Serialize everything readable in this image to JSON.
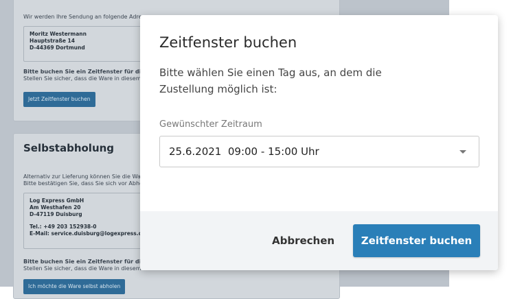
{
  "background": {
    "delivery_card": {
      "intro": "Wir werden Ihre Sendung an folgende Adresse",
      "address_lines": [
        "Moritz Westermann",
        "Hauptstraße 14",
        "D-44369 Dortmund"
      ],
      "note_line1": "Bitte buchen Sie ein Zeitfenster für die Liefe",
      "note_line2": "Stellen Sie sicher, dass die Ware in diesem Zei",
      "button": "Jetzt Zeitfenster buchen"
    },
    "pickup_card": {
      "title": "Selbstabholung",
      "intro_line1": "Alternativ zur Lieferung können Sie die Ware a",
      "intro_line2": "Bitte bestätigen Sie, dass Sie sich vor Abholu",
      "address_lines": [
        "Log Express GmbH",
        "Am Westhafen 20",
        "D-47119 Duisburg"
      ],
      "contact_lines": [
        "Tel.: +49 203 152938-0",
        "E-Mail: service.duisburg@logexpress.de"
      ],
      "note_line1": "Bitte buchen Sie ein Zeitfenster für die Liefe",
      "note_line2": "Stellen Sie sicher, dass die Ware in diesem Zei",
      "button": "Ich möchte die Ware selbst abholen"
    }
  },
  "modal": {
    "title": "Zeitfenster buchen",
    "description": "Bitte wählen Sie einen Tag aus, an dem die Zustellung möglich ist:",
    "field_label": "Gewünschter Zeitraum",
    "selected_value": "25.6.2021  09:00 - 15:00 Uhr",
    "cancel_label": "Abbrechen",
    "confirm_label": "Zeitfenster buchen"
  }
}
